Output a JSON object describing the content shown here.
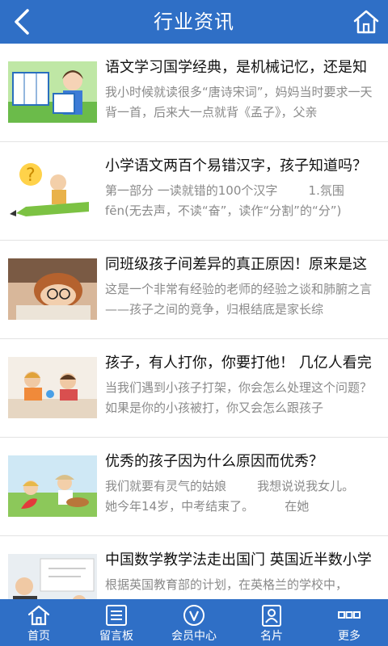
{
  "header": {
    "title": "行业资讯"
  },
  "articles": [
    {
      "title": "语文学习国学经典，是机械记忆，还是知",
      "desc": "我小时候就读很多“唐诗宋词”，妈妈当时要求一天背一首，后来大一点就背《孟子》，父亲"
    },
    {
      "title": "小学语文两百个易错汉字，孩子知道吗？",
      "desc": "第一部分 一读就错的100个汉字        1.氛围 fēn(无去声，不读“奋”，读作“分割”的“分”)"
    },
    {
      "title": "同班级孩子间差异的真正原因！原来是这",
      "desc": "这是一个非常有经验的老师的经验之谈和肺腑之言——孩子之间的竞争，归根结底是家长综"
    },
    {
      "title": "孩子，有人打你，你要打他！ 几亿人看完",
      "desc": "当我们遇到小孩子打架，你会怎么处理这个问题？如果是你的小孩被打，你又会怎么跟孩子"
    },
    {
      "title": "优秀的孩子因为什么原因而优秀？",
      "desc": "我们就要有灵气的姑娘        我想说说我女儿。      她今年14岁，中考结束了。        在她"
    },
    {
      "title": "中国数学教学法走出国门 英国近半数小学",
      "desc": "根据英国教育部的计划，在英格兰的学校中，"
    }
  ],
  "tabbar": [
    {
      "label": "首页",
      "icon": "home-icon"
    },
    {
      "label": "留言板",
      "icon": "message-board-icon"
    },
    {
      "label": "会员中心",
      "icon": "member-icon"
    },
    {
      "label": "名片",
      "icon": "card-icon"
    },
    {
      "label": "更多",
      "icon": "more-icon"
    }
  ],
  "colors": {
    "primary": "#2f6fc6",
    "title_text": "#111111",
    "desc_text": "#8a8a8a"
  }
}
